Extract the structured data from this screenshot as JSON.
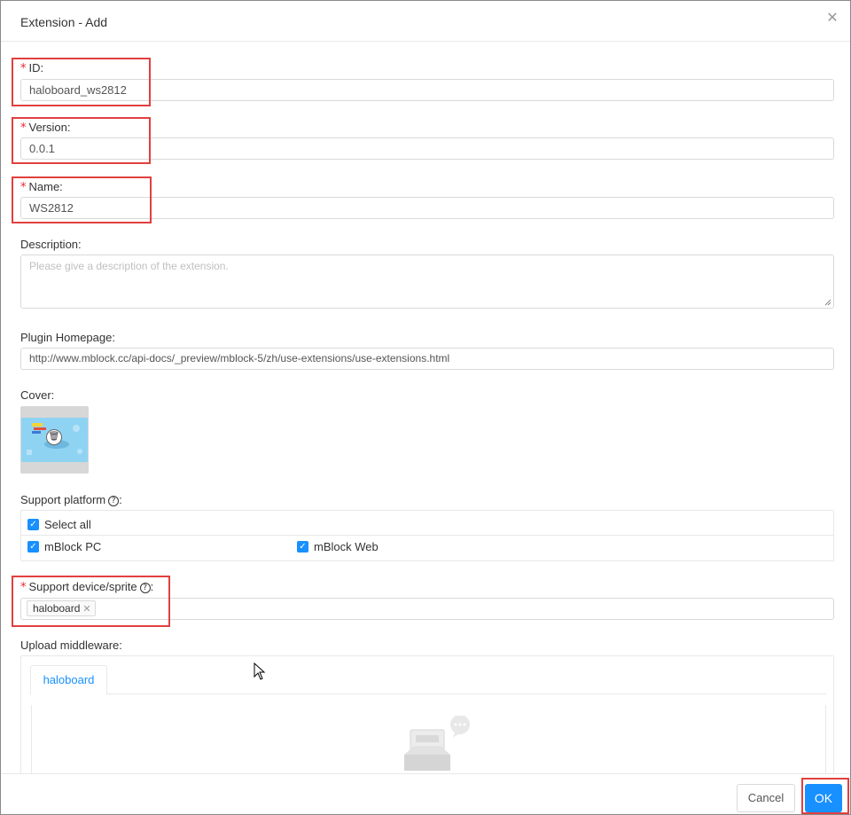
{
  "dialog": {
    "title": "Extension - Add",
    "close_icon": "close-icon"
  },
  "form": {
    "id": {
      "label": "ID:",
      "value": "haloboard_ws2812",
      "required": true
    },
    "version": {
      "label": "Version:",
      "value": "0.0.1",
      "required": true
    },
    "name": {
      "label": "Name:",
      "value": "WS2812",
      "required": true
    },
    "description": {
      "label": "Description:",
      "placeholder": "Please give a description of the extension."
    },
    "homepage": {
      "label": "Plugin Homepage:",
      "value": "http://www.mblock.cc/api-docs/_preview/mblock-5/zh/use-extensions/use-extensions.html"
    },
    "cover": {
      "label": "Cover:",
      "icon": "trash-icon"
    },
    "platform": {
      "label": "Support platform",
      "label_suffix": ":",
      "select_all": "Select all",
      "options": [
        "mBlock PC",
        "mBlock Web"
      ]
    },
    "device": {
      "label": "Support device/sprite",
      "label_suffix": ":",
      "required": true,
      "tags": [
        "haloboard"
      ]
    },
    "middleware": {
      "label": "Upload middleware:",
      "tabs": [
        "haloboard"
      ]
    }
  },
  "footer": {
    "cancel": "Cancel",
    "ok": "OK"
  },
  "colors": {
    "primary": "#1890ff",
    "required": "#f5222d",
    "highlight": "#e0403f"
  }
}
